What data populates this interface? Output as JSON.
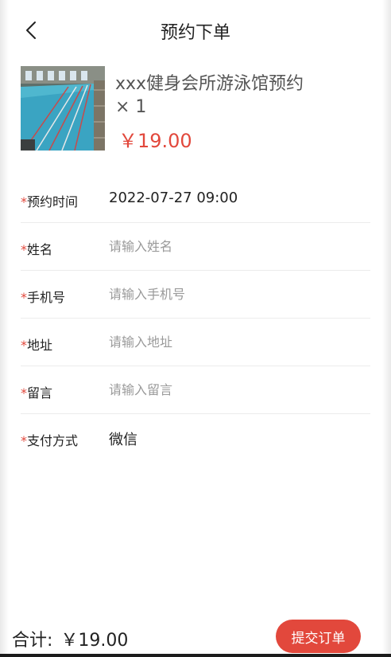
{
  "header": {
    "title": "预约下单",
    "back_icon": "chevron-left-icon"
  },
  "product": {
    "name": "xxx健身会所游泳馆预约",
    "quantity": "× 1",
    "price": "￥19.00",
    "image": "swimming-pool-photo"
  },
  "form": {
    "rows": [
      {
        "required": "*",
        "label": "预约时间",
        "value": "2022-07-27 09:00"
      },
      {
        "required": "*",
        "label": "姓名",
        "placeholder": "请输入姓名"
      },
      {
        "required": "*",
        "label": "手机号",
        "placeholder": "请输入手机号"
      },
      {
        "required": "*",
        "label": "地址",
        "placeholder": "请输入地址"
      },
      {
        "required": "*",
        "label": "留言",
        "placeholder": "请输入留言"
      },
      {
        "required": "*",
        "label": "支付方式",
        "value": "微信"
      }
    ]
  },
  "footer": {
    "total_label": "合计:",
    "total_value": "￥19.00",
    "submit_label": "提交订单"
  },
  "colors": {
    "accent": "#e2483c",
    "text": "#222222",
    "placeholder": "#9a9a9a",
    "divider": "#ececec"
  }
}
